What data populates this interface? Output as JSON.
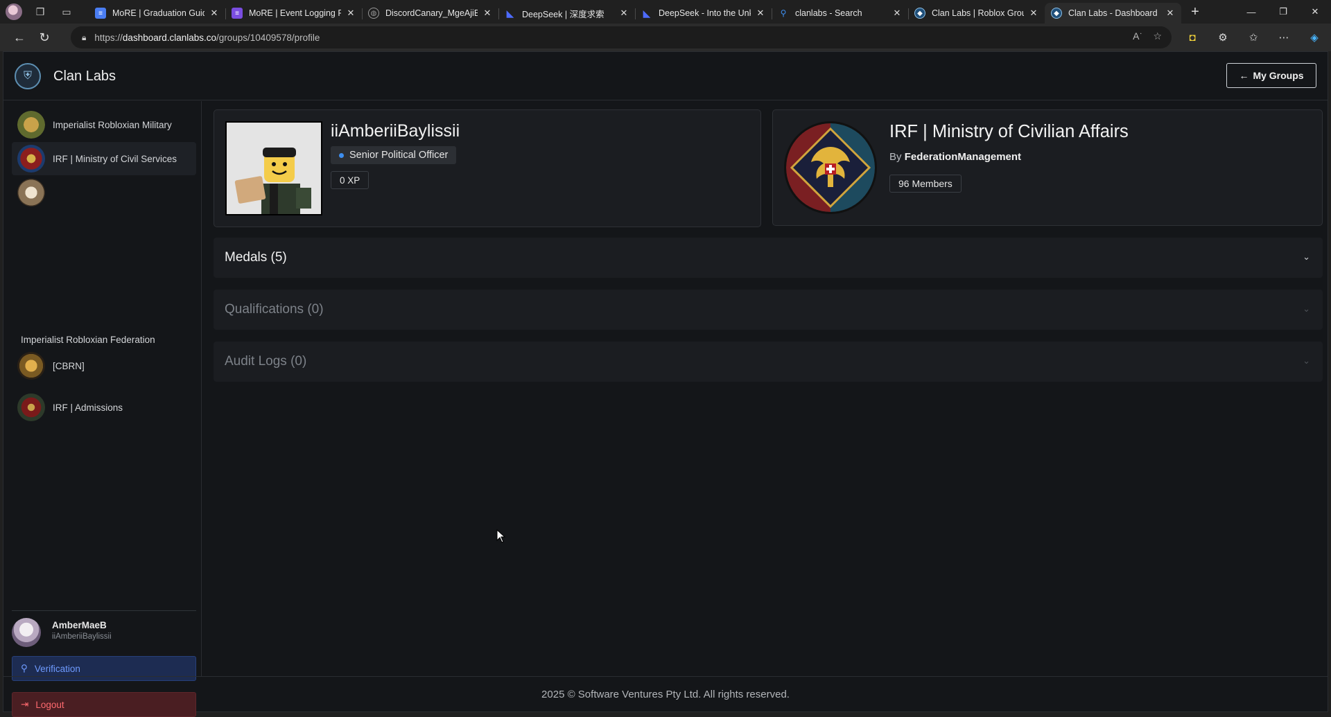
{
  "browser": {
    "tabs": [
      {
        "title": "MoRE | Graduation Guide",
        "favicon": "docs-icon",
        "color": "#4a7df2",
        "active": false
      },
      {
        "title": "MoRE | Event Logging Form",
        "favicon": "forms-icon",
        "color": "#7a4de0",
        "active": false
      },
      {
        "title": "DiscordCanary_MgeAjiByl",
        "favicon": "globe-icon",
        "color": "#555555",
        "active": false
      },
      {
        "title": "DeepSeek | 深度求索",
        "favicon": "deepseek-icon",
        "color": "#4d6bfe",
        "active": false
      },
      {
        "title": "DeepSeek - Into the Unknown",
        "favicon": "deepseek-icon",
        "color": "#4d6bfe",
        "active": false
      },
      {
        "title": "clanlabs - Search",
        "favicon": "search-icon",
        "color": "#2b2b2b",
        "active": false
      },
      {
        "title": "Clan Labs | Roblox Group",
        "favicon": "clanlabs-icon",
        "color": "#1f4f7a",
        "active": false
      },
      {
        "title": "Clan Labs - Dashboard",
        "favicon": "clanlabs-icon",
        "color": "#1f4f7a",
        "active": true
      }
    ],
    "url_prefix": "https://",
    "url_host": "dashboard.clanlabs.co",
    "url_path": "/groups/10409578/profile"
  },
  "header": {
    "brand": "Clan Labs",
    "my_groups_label": "My Groups"
  },
  "sidebar": {
    "groups": [
      {
        "name": "Imperialist Robloxian Military",
        "colors": [
          "#c9a24a",
          "#5f6a2e"
        ]
      },
      {
        "name": "IRF | Ministry of Civil Services",
        "colors": [
          "#8b1e1e",
          "#1c3b6e"
        ]
      },
      {
        "name": "Imperialist Robloxian Federation",
        "colors": [
          "#d9c7a8",
          "#5b4a32"
        ]
      },
      {
        "name": "[CBRN]",
        "colors": [
          "#d9a441",
          "#3a2a15"
        ]
      },
      {
        "name": "IRF | Admissions",
        "colors": [
          "#7a1a1a",
          "#2d3a2a"
        ]
      }
    ],
    "user": {
      "display_name": "AmberMaeB",
      "username": "iiAmberiiBaylissii"
    },
    "verification_label": "Verification",
    "logout_label": "Logout"
  },
  "profile": {
    "username": "iiAmberiiBaylissii",
    "rank": "Senior Political Officer",
    "xp": "0 XP"
  },
  "group": {
    "title": "IRF | Ministry of Civilian Affairs",
    "by_prefix": "By",
    "owner": "FederationManagement",
    "members": "96 Members"
  },
  "sections": [
    {
      "title": "Medals (5)",
      "enabled": true
    },
    {
      "title": "Qualifications (0)",
      "enabled": false
    },
    {
      "title": "Audit Logs (0)",
      "enabled": false
    }
  ],
  "footer": "2025 © Software Ventures Pty Ltd. All rights reserved."
}
